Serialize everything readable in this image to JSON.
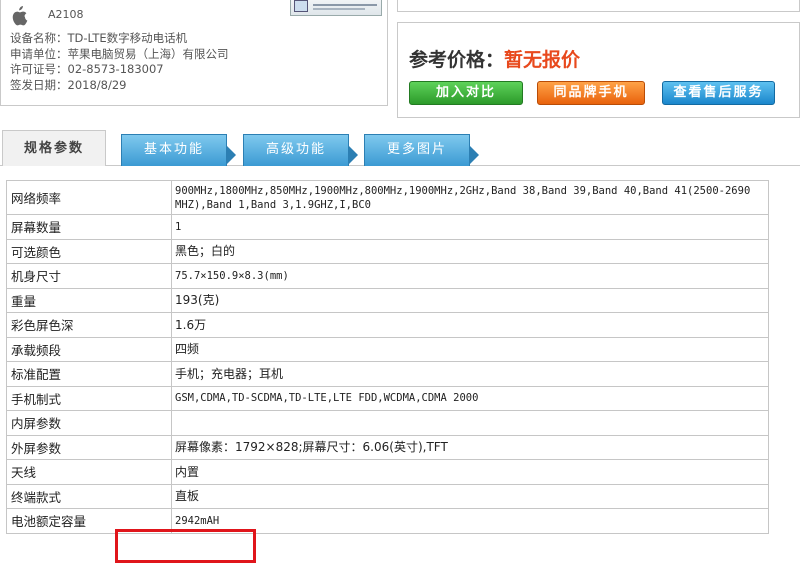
{
  "device": {
    "model": "A2108",
    "lines": [
      "设备名称：TD-LTE数字移动电话机",
      "申请单位：苹果电脑贸易（上海）有限公司",
      "许可证号：02-8573-183007",
      "签发日期：2018/8/29"
    ]
  },
  "price": {
    "label": "参考价格：",
    "value": "暂无报价"
  },
  "buttons": {
    "compare": "加入对比",
    "same_brand": "同品牌手机",
    "service": "查看售后服务"
  },
  "tabs": [
    "规格参数",
    "基本功能",
    "高级功能",
    "更多图片"
  ],
  "specs": [
    {
      "key": "网络频率",
      "value": "900MHz,1800MHz,850MHz,1900MHz,800MHz,1900MHz,2GHz,Band 38,Band 39,Band 40,Band 41(2500-2690 MHZ),Band 1,Band 3,1.9GHZ,I,BC0"
    },
    {
      "key": "屏幕数量",
      "value": "1"
    },
    {
      "key": "可选颜色",
      "value": "黑色；白的"
    },
    {
      "key": "机身尺寸",
      "value": "75.7×150.9×8.3(mm)"
    },
    {
      "key": "重量",
      "value": "193(克)"
    },
    {
      "key": "彩色屏色深",
      "value": "1.6万"
    },
    {
      "key": "承载频段",
      "value": "四频"
    },
    {
      "key": "标准配置",
      "value": "手机；充电器；耳机"
    },
    {
      "key": "手机制式",
      "value": "GSM,CDMA,TD-SCDMA,TD-LTE,LTE FDD,WCDMA,CDMA 2000"
    },
    {
      "key": "内屏参数",
      "value": ""
    },
    {
      "key": "外屏参数",
      "value": "屏幕像素：1792×828;屏幕尺寸：6.06(英寸),TFT"
    },
    {
      "key": "天线",
      "value": "内置"
    },
    {
      "key": "终端款式",
      "value": "直板"
    },
    {
      "key": "电池额定容量",
      "value": "2942mAH"
    }
  ],
  "colors": {
    "price_value": "#e8491d",
    "highlight": "#e0151b",
    "tab_blue": "#3b9ad3",
    "btn_green": "#2c9a2a",
    "btn_orange": "#e8620c",
    "btn_blue": "#1a86cc"
  }
}
